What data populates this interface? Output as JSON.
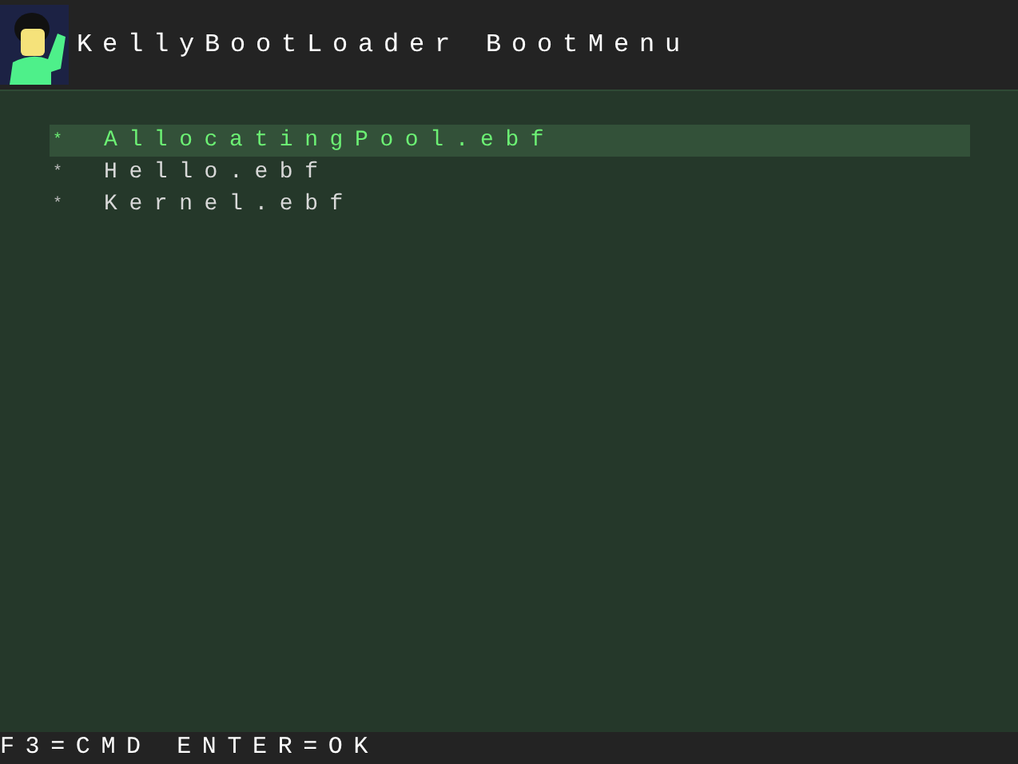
{
  "header": {
    "title": "KellyBootLoader BootMenu"
  },
  "menu": {
    "items": [
      {
        "marker": "*",
        "label": "AllocatingPool.ebf",
        "selected": true
      },
      {
        "marker": "*",
        "label": "Hello.ebf",
        "selected": false
      },
      {
        "marker": "*",
        "label": "Kernel.ebf",
        "selected": false
      }
    ]
  },
  "footer": {
    "hint": "F3=CMD ENTER=OK"
  }
}
